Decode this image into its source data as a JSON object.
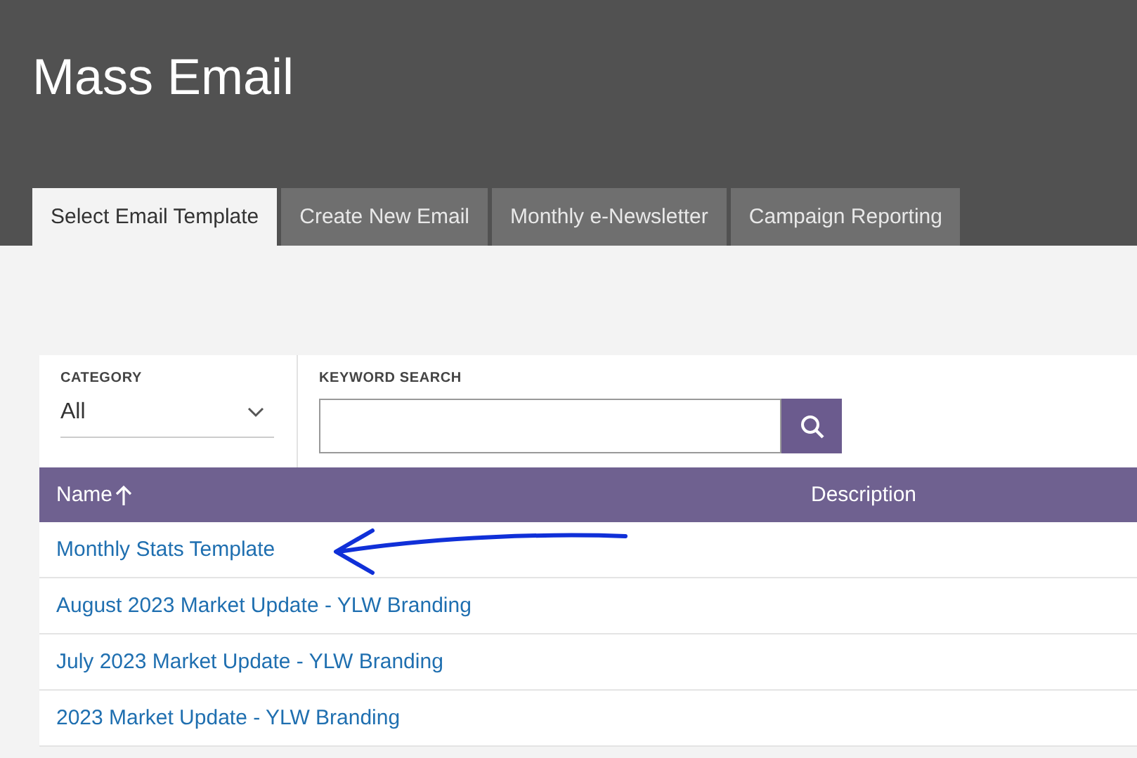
{
  "page": {
    "title": "Mass Email"
  },
  "tabs": [
    {
      "label": "Select Email Template",
      "selected": true
    },
    {
      "label": "Create New Email",
      "selected": false
    },
    {
      "label": "Monthly e-Newsletter",
      "selected": false
    },
    {
      "label": "Campaign Reporting",
      "selected": false
    }
  ],
  "filters": {
    "category": {
      "label": "CATEGORY",
      "value": "All"
    },
    "keyword_search": {
      "label": "KEYWORD SEARCH"
    }
  },
  "table": {
    "columns": [
      {
        "label": "Name",
        "sorted": true
      },
      {
        "label": "Description"
      }
    ],
    "rows": [
      {
        "name": "Monthly Stats Template",
        "annotated": true
      },
      {
        "name": "August 2023 Market Update - YLW Branding",
        "annotated": false
      },
      {
        "name": "July 2023 Market Update - YLW Branding",
        "annotated": false
      },
      {
        "name": "2023 Market Update - YLW Branding",
        "annotated": false
      }
    ]
  }
}
